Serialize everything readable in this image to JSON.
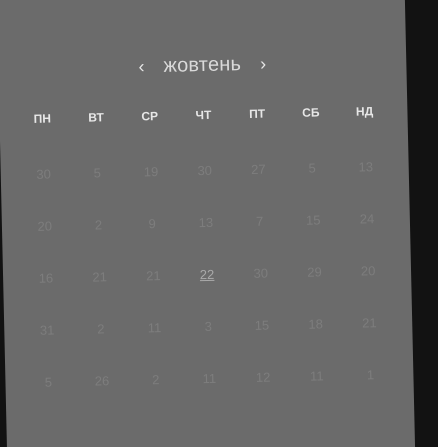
{
  "calendar": {
    "month": "жовтень",
    "prev": "‹",
    "next": "›",
    "weekdays": [
      "ПН",
      "ВТ",
      "СР",
      "ЧТ",
      "ПТ",
      "СБ",
      "НД"
    ],
    "weeks": [
      [
        "30",
        "5",
        "19",
        "30",
        "27",
        "5",
        "13"
      ],
      [
        "20",
        "2",
        "9",
        "13",
        "7",
        "15",
        "24"
      ],
      [
        "16",
        "21",
        "21",
        "22",
        "30",
        "29",
        "20"
      ],
      [
        "31",
        "2",
        "11",
        "3",
        "15",
        "18",
        "21"
      ],
      [
        "5",
        "26",
        "2",
        "11",
        "12",
        "11",
        "1"
      ]
    ],
    "highlighted_day": "22"
  }
}
